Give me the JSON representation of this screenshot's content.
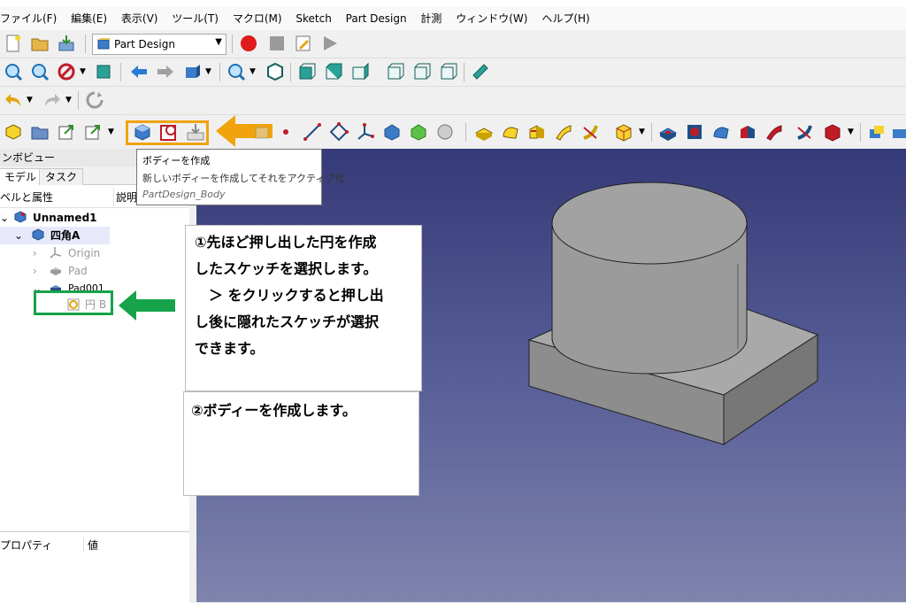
{
  "menubar": {
    "items": [
      "ファイル(F)",
      "編集(E)",
      "表示(V)",
      "ツール(T)",
      "マクロ(M)",
      "Sketch",
      "Part Design",
      "計測",
      "ウィンドウ(W)",
      "ヘルプ(H)"
    ]
  },
  "workbench_selector": {
    "value": "Part Design"
  },
  "combo": {
    "title": "ンボビュー",
    "tabs": [
      "モデル",
      "タスク"
    ],
    "tree_header": [
      "ベルと属性",
      "説明"
    ],
    "tree": {
      "document": "Unnamed1",
      "body": "四角A",
      "origin": "Origin",
      "pad": "Pad",
      "pad001": "Pad001",
      "sketch": "円 B"
    },
    "properties_header": [
      "プロパティ",
      "値"
    ]
  },
  "tooltip": {
    "title": "ボディーを作成",
    "description": "新しいボディーを作成してそれをアクティブ化",
    "command": "PartDesign_Body"
  },
  "annotations": {
    "note1_lines": [
      "①先ほど押し出した円を作成",
      "したスケッチを選択します。",
      "　＞ をクリックすると押し出",
      "し後に隠れたスケッチが選択",
      "できます。"
    ],
    "note2": "②ボディーを作成します。"
  },
  "colors": {
    "highlight_orange": "#f0a30a",
    "highlight_green": "#16a34a",
    "viewport_top": "#353a78",
    "viewport_bottom": "#7f84ad"
  }
}
